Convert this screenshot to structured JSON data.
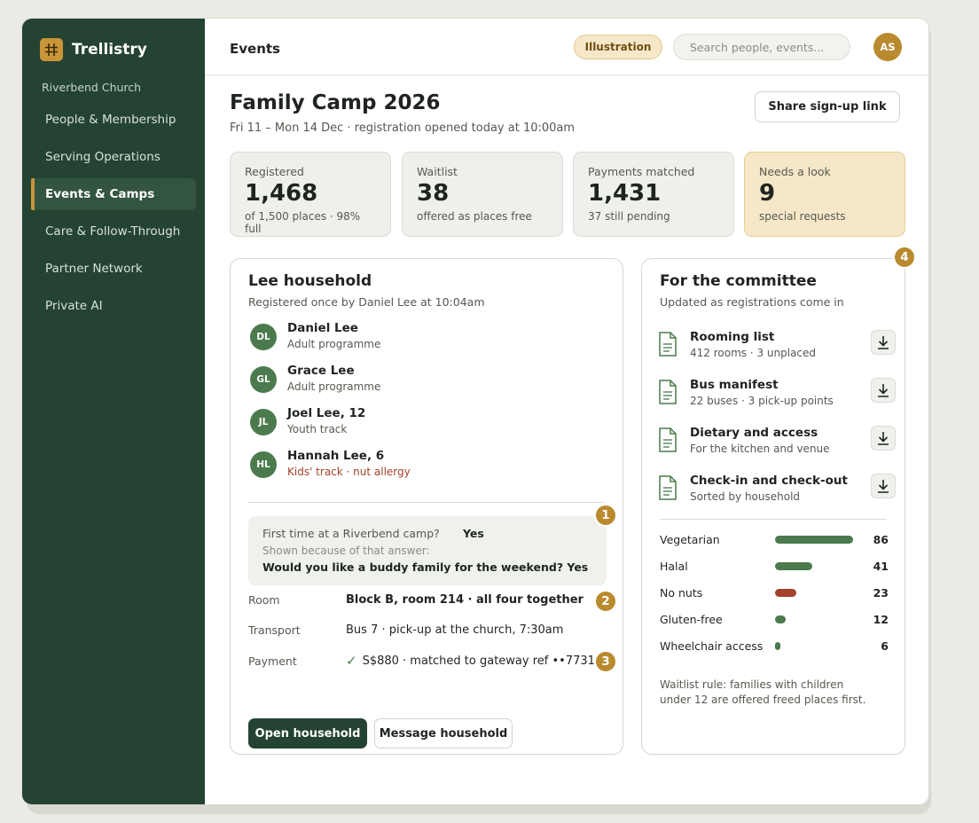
{
  "app": {
    "name": "Trellistry",
    "org": "Riverbend Church"
  },
  "sidebar": {
    "items": [
      {
        "label": "People & Membership"
      },
      {
        "label": "Serving Operations"
      },
      {
        "label": "Events & Camps"
      },
      {
        "label": "Care & Follow-Through"
      },
      {
        "label": "Partner Network"
      },
      {
        "label": "Private AI"
      }
    ],
    "active_index": 2
  },
  "topbar": {
    "title": "Events",
    "pill": "Illustration",
    "search_placeholder": "Search people, events...",
    "avatar_initials": "AS"
  },
  "event": {
    "title": "Family Camp 2026",
    "subtitle": "Fri 11 – Mon 14 Dec · registration opened today at 10:00am",
    "share_label": "Share sign-up link"
  },
  "stats": [
    {
      "label": "Registered",
      "value": "1,468",
      "note": "of 1,500 places · 98% full"
    },
    {
      "label": "Waitlist",
      "value": "38",
      "note": "offered as places free"
    },
    {
      "label": "Payments matched",
      "value": "1,431",
      "note": "37 still pending"
    },
    {
      "label": "Needs a look",
      "value": "9",
      "note": "special requests"
    }
  ],
  "household": {
    "title": "Lee household",
    "subtitle": "Registered once by Daniel Lee at 10:04am",
    "members": [
      {
        "initials": "DL",
        "name": "Daniel Lee",
        "track": "Adult programme"
      },
      {
        "initials": "GL",
        "name": "Grace Lee",
        "track": "Adult programme"
      },
      {
        "initials": "JL",
        "name": "Joel Lee, 12",
        "track": "Youth track"
      },
      {
        "initials": "HL",
        "name": "Hannah Lee, 6",
        "track": "Kids' track · nut allergy"
      }
    ],
    "question": {
      "q": "First time at a Riverbend camp?",
      "a": "Yes",
      "shown": "Shown because of that answer:",
      "follow": "Would you like a buddy family for the weekend? Yes"
    },
    "details": [
      {
        "label": "Room",
        "value": "Block B, room 214 · all four together"
      },
      {
        "label": "Transport",
        "value": "Bus 7 · pick-up at the church, 7:30am"
      },
      {
        "label": "Payment",
        "value": "S$880 · matched to gateway ref ••7731"
      }
    ],
    "open_label": "Open household",
    "message_label": "Message household"
  },
  "badges": [
    "1",
    "2",
    "3",
    "4"
  ],
  "committee": {
    "title": "For the committee",
    "subtitle": "Updated as registrations come in",
    "exports": [
      {
        "title": "Rooming list",
        "sub": "412 rooms · 3 unplaced"
      },
      {
        "title": "Bus manifest",
        "sub": "22 buses · 3 pick-up points"
      },
      {
        "title": "Dietary and access",
        "sub": "For the kitchen and venue"
      },
      {
        "title": "Check-in and check-out",
        "sub": "Sorted by household"
      }
    ],
    "dietary": [
      {
        "label": "Vegetarian",
        "count": "86",
        "value": 86
      },
      {
        "label": "Halal",
        "count": "41",
        "value": 41
      },
      {
        "label": "No nuts",
        "count": "23",
        "value": 23
      },
      {
        "label": "Gluten-free",
        "count": "12",
        "value": 12
      },
      {
        "label": "Wheelchair access",
        "count": "6",
        "value": 6
      }
    ],
    "rule": "Waitlist rule: families with children under 12 are offered freed places first."
  },
  "colors": {
    "sidebar": "#244332",
    "accent": "#b98a2e",
    "bar": "#4b7a4d",
    "alert": "#a3412c"
  }
}
